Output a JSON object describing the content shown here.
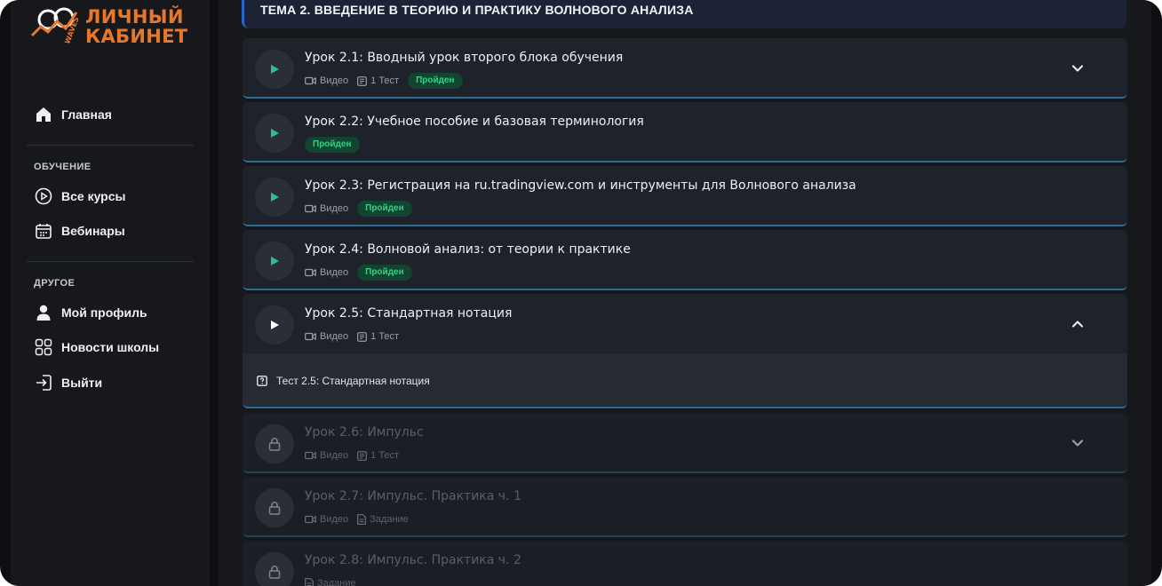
{
  "logo": {
    "line1": "ЛИЧНЫЙ",
    "line2": "КАБИНЕТ",
    "mark_text": "WAVES"
  },
  "nav": {
    "home": "Главная",
    "section_learning": "ОБУЧЕНИЕ",
    "all_courses": "Все курсы",
    "webinars": "Вебинары",
    "section_other": "ДРУГОЕ",
    "profile": "Мой профиль",
    "news": "Новости школы",
    "logout": "Выйти"
  },
  "topic_title": "ТЕМА 2. ВВЕДЕНИЕ В ТЕОРИЮ И ПРАКТИКУ ВОЛНОВОГО АНАЛИЗА",
  "lessons": [
    {
      "title": "Урок 2.1: Вводный урок второго блока обучения",
      "video": "Видео",
      "test": "1 Тест",
      "status": "Пройден"
    },
    {
      "title": "Урок 2.2: Учебное пособие и базовая терминология",
      "status": "Пройден"
    },
    {
      "title": "Урок 2.3: Регистрация на ru.tradingview.com и инструменты для Волнового анализа",
      "video": "Видео",
      "status": "Пройден"
    },
    {
      "title": "Урок 2.4: Волновой анализ: от теории к практике",
      "video": "Видео",
      "status": "Пройден"
    },
    {
      "title": "Урок 2.5: Стандартная нотация",
      "video": "Видео",
      "test": "1 Тест"
    },
    {
      "title": "Урок 2.6: Импульс",
      "video": "Видео",
      "test": "1 Тест"
    },
    {
      "title": "Урок 2.7: Импульс. Практика ч. 1",
      "video": "Видео",
      "task": "Задание"
    },
    {
      "title": "Урок 2.8: Импульс. Практика ч. 2",
      "task": "Задание"
    }
  ],
  "expanded_test": "Тест 2.5: Стандартная нотация",
  "colors": {
    "accent_orange": "#e8772a",
    "done_green": "#35d08a",
    "play_green": "#2fbf8a",
    "line_blue": "#2d6d8f"
  }
}
